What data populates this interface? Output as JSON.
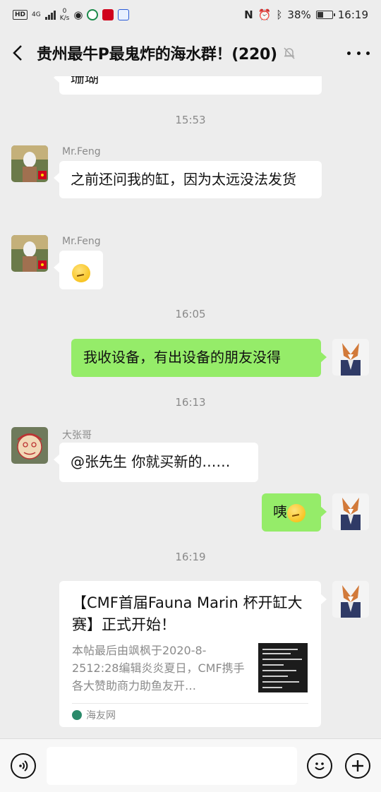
{
  "status_bar": {
    "hd": "HD",
    "network": "4G",
    "speed_value": "0",
    "speed_unit": "K/s",
    "battery": "38%",
    "time": "16:19"
  },
  "header": {
    "title": "贵州最牛P最鬼炸的海水群！(220)"
  },
  "chat": {
    "partial_text": "珊瑚",
    "messages": [
      {
        "time": "15:53"
      },
      {
        "sender": "Mr.Feng",
        "text": "之前还问我的缸，因为太远没法发货"
      },
      {
        "sender": "Mr.Feng",
        "emoji": "thinking-face"
      },
      {
        "time": "16:05"
      },
      {
        "self": true,
        "text": "我收设备，有出设备的朋友没得"
      },
      {
        "time": "16:13"
      },
      {
        "sender": "大张哥",
        "text": "@张先生  你就买新的……"
      },
      {
        "self": true,
        "text": "咦"
      },
      {
        "time": "16:19"
      }
    ],
    "link_card": {
      "title": "【CMF首届Fauna Marin 杯开缸大赛】正式开始！",
      "desc": "本帖最后由飒枫于2020-8-2512:28编辑炎炎夏日，CMF携手各大赞助商力助鱼友开…",
      "source": "海友网"
    }
  },
  "colors": {
    "background": "#ededed",
    "self_bubble": "#95ec69",
    "other_bubble": "#ffffff",
    "meta_text": "#8a8a8a"
  }
}
